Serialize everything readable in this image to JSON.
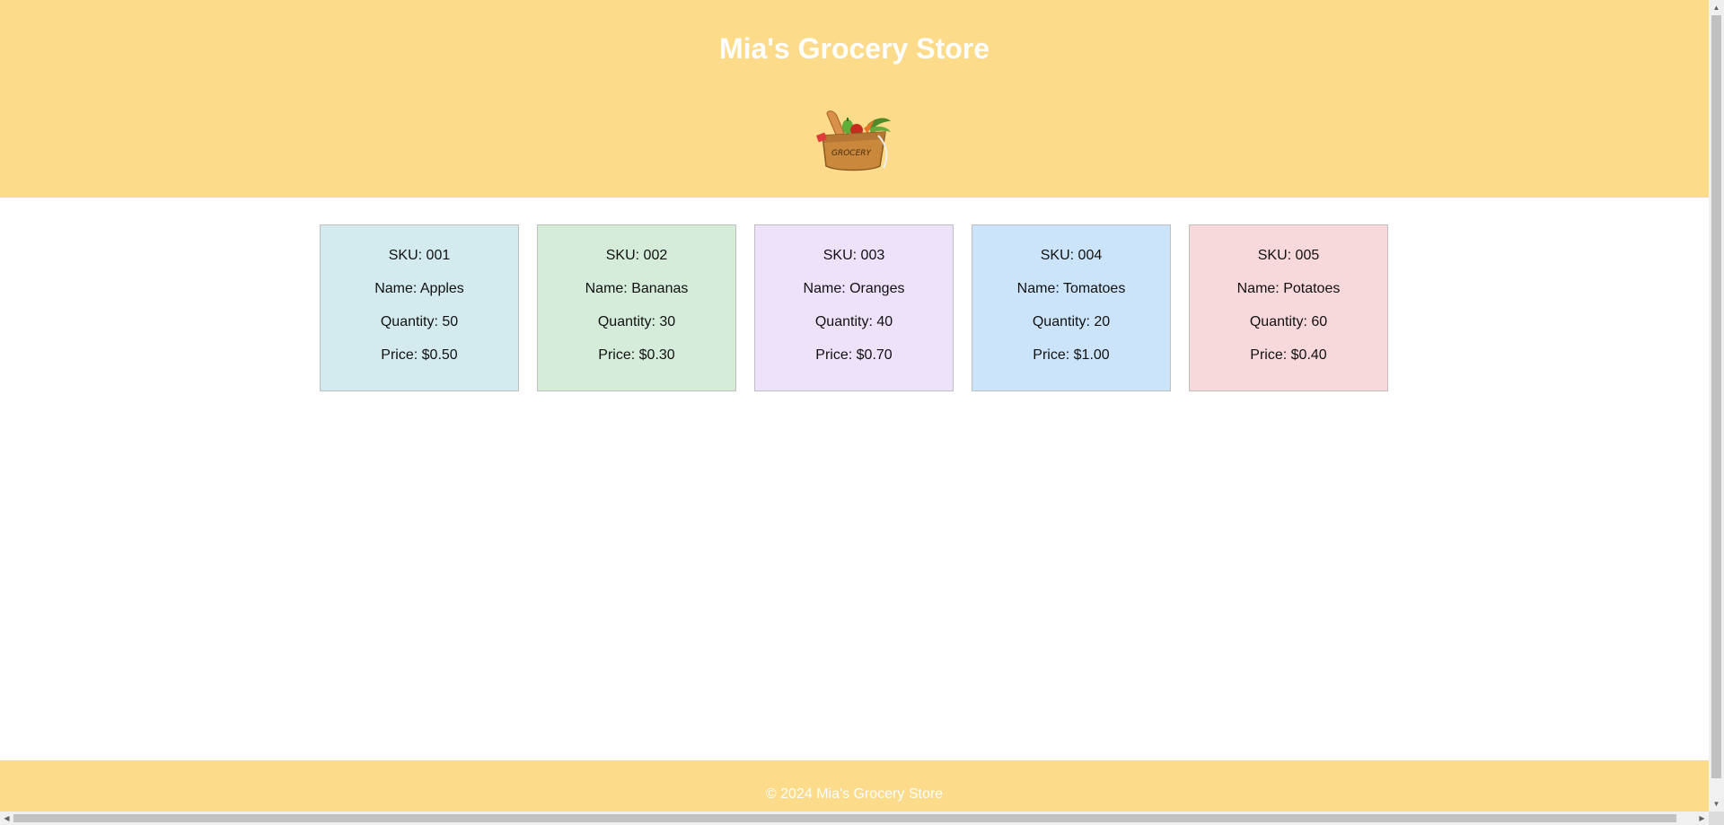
{
  "header": {
    "title": "Mia's Grocery Store",
    "logo_icon": "grocery-bag-icon",
    "logo_text": "GROCERY",
    "background": "#fcdb8a"
  },
  "products": [
    {
      "sku": "SKU: 001",
      "name": "Name: Apples",
      "quantity": "Quantity: 50",
      "price": "Price: $0.50",
      "color": "#d3ebef"
    },
    {
      "sku": "SKU: 002",
      "name": "Name: Bananas",
      "quantity": "Quantity: 30",
      "price": "Price: $0.30",
      "color": "#d5ecdb"
    },
    {
      "sku": "SKU: 003",
      "name": "Name: Oranges",
      "quantity": "Quantity: 40",
      "price": "Price: $0.70",
      "color": "#eee1fa"
    },
    {
      "sku": "SKU: 004",
      "name": "Name: Tomatoes",
      "quantity": "Quantity: 20",
      "price": "Price: $1.00",
      "color": "#cce4fa"
    },
    {
      "sku": "SKU: 005",
      "name": "Name: Potatoes",
      "quantity": "Quantity: 60",
      "price": "Price: $0.40",
      "color": "#f7d8db"
    }
  ],
  "footer": {
    "text": "© 2024 Mia's Grocery Store"
  }
}
